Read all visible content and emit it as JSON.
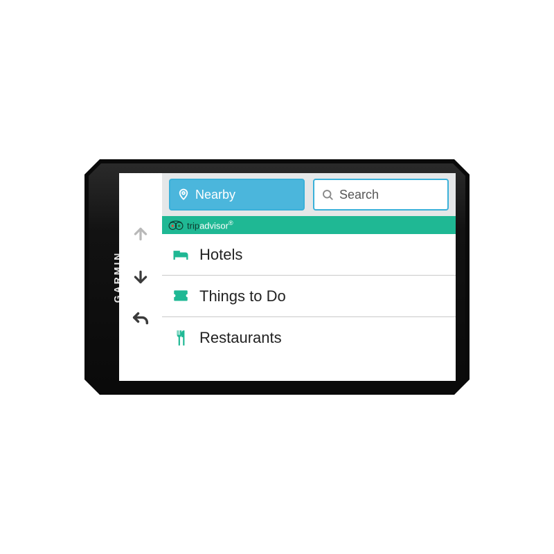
{
  "brand": "GARMIN",
  "header": {
    "nearby_label": "Nearby",
    "search_placeholder": "Search"
  },
  "tripadvisor": {
    "prefix": "trip",
    "suffix": "advisor",
    "registered": "®"
  },
  "categories": [
    {
      "key": "hotels",
      "label": "Hotels",
      "icon": "bed-icon"
    },
    {
      "key": "things",
      "label": "Things to Do",
      "icon": "ticket-icon"
    },
    {
      "key": "restaurants",
      "label": "Restaurants",
      "icon": "fork-knife-icon"
    }
  ],
  "nav": {
    "up_enabled": false,
    "down_enabled": true,
    "back_enabled": true
  },
  "colors": {
    "accent_blue": "#4bb6dc",
    "accent_blue_border": "#39b0d9",
    "tripadvisor_green": "#1fb894",
    "header_bg": "#e5e7e8"
  }
}
